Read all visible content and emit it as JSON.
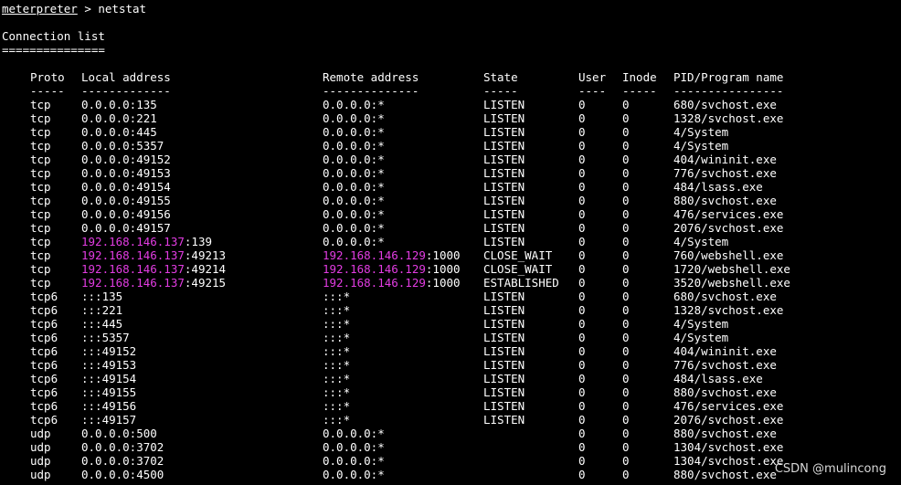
{
  "prompt": {
    "name": "meterpreter",
    "symbol": " > ",
    "command": "netstat"
  },
  "title": "Connection list",
  "title_rule": "===============",
  "headers": {
    "proto": "Proto",
    "local": "Local address",
    "remote": "Remote address",
    "state": "State",
    "user": "User",
    "inode": "Inode",
    "pid": "PID/Program name"
  },
  "rules": {
    "proto": "-----",
    "local": "-------------",
    "remote": "--------------",
    "state": "-----",
    "user": "----",
    "inode": "-----",
    "pid": "----------------"
  },
  "highlight_color": "#e23ce2",
  "connections": [
    {
      "proto": "tcp",
      "local_ip": "",
      "local_rest": "0.0.0.0:135",
      "remote_ip": "",
      "remote_rest": "0.0.0.0:*",
      "state": "LISTEN",
      "user": "0",
      "inode": "0",
      "pid": "680/svchost.exe"
    },
    {
      "proto": "tcp",
      "local_ip": "",
      "local_rest": "0.0.0.0:221",
      "remote_ip": "",
      "remote_rest": "0.0.0.0:*",
      "state": "LISTEN",
      "user": "0",
      "inode": "0",
      "pid": "1328/svchost.exe"
    },
    {
      "proto": "tcp",
      "local_ip": "",
      "local_rest": "0.0.0.0:445",
      "remote_ip": "",
      "remote_rest": "0.0.0.0:*",
      "state": "LISTEN",
      "user": "0",
      "inode": "0",
      "pid": "4/System"
    },
    {
      "proto": "tcp",
      "local_ip": "",
      "local_rest": "0.0.0.0:5357",
      "remote_ip": "",
      "remote_rest": "0.0.0.0:*",
      "state": "LISTEN",
      "user": "0",
      "inode": "0",
      "pid": "4/System"
    },
    {
      "proto": "tcp",
      "local_ip": "",
      "local_rest": "0.0.0.0:49152",
      "remote_ip": "",
      "remote_rest": "0.0.0.0:*",
      "state": "LISTEN",
      "user": "0",
      "inode": "0",
      "pid": "404/wininit.exe"
    },
    {
      "proto": "tcp",
      "local_ip": "",
      "local_rest": "0.0.0.0:49153",
      "remote_ip": "",
      "remote_rest": "0.0.0.0:*",
      "state": "LISTEN",
      "user": "0",
      "inode": "0",
      "pid": "776/svchost.exe"
    },
    {
      "proto": "tcp",
      "local_ip": "",
      "local_rest": "0.0.0.0:49154",
      "remote_ip": "",
      "remote_rest": "0.0.0.0:*",
      "state": "LISTEN",
      "user": "0",
      "inode": "0",
      "pid": "484/lsass.exe"
    },
    {
      "proto": "tcp",
      "local_ip": "",
      "local_rest": "0.0.0.0:49155",
      "remote_ip": "",
      "remote_rest": "0.0.0.0:*",
      "state": "LISTEN",
      "user": "0",
      "inode": "0",
      "pid": "880/svchost.exe"
    },
    {
      "proto": "tcp",
      "local_ip": "",
      "local_rest": "0.0.0.0:49156",
      "remote_ip": "",
      "remote_rest": "0.0.0.0:*",
      "state": "LISTEN",
      "user": "0",
      "inode": "0",
      "pid": "476/services.exe"
    },
    {
      "proto": "tcp",
      "local_ip": "",
      "local_rest": "0.0.0.0:49157",
      "remote_ip": "",
      "remote_rest": "0.0.0.0:*",
      "state": "LISTEN",
      "user": "0",
      "inode": "0",
      "pid": "2076/svchost.exe"
    },
    {
      "proto": "tcp",
      "local_ip": "192.168.146.137",
      "local_rest": ":139",
      "remote_ip": "",
      "remote_rest": "0.0.0.0:*",
      "state": "LISTEN",
      "user": "0",
      "inode": "0",
      "pid": "4/System"
    },
    {
      "proto": "tcp",
      "local_ip": "192.168.146.137",
      "local_rest": ":49213",
      "remote_ip": "192.168.146.129",
      "remote_rest": ":1000",
      "state": "CLOSE_WAIT",
      "user": "0",
      "inode": "0",
      "pid": "760/webshell.exe"
    },
    {
      "proto": "tcp",
      "local_ip": "192.168.146.137",
      "local_rest": ":49214",
      "remote_ip": "192.168.146.129",
      "remote_rest": ":1000",
      "state": "CLOSE_WAIT",
      "user": "0",
      "inode": "0",
      "pid": "1720/webshell.exe"
    },
    {
      "proto": "tcp",
      "local_ip": "192.168.146.137",
      "local_rest": ":49215",
      "remote_ip": "192.168.146.129",
      "remote_rest": ":1000",
      "state": "ESTABLISHED",
      "user": "0",
      "inode": "0",
      "pid": "3520/webshell.exe"
    },
    {
      "proto": "tcp6",
      "local_ip": "",
      "local_rest": ":::135",
      "remote_ip": "",
      "remote_rest": ":::*",
      "state": "LISTEN",
      "user": "0",
      "inode": "0",
      "pid": "680/svchost.exe"
    },
    {
      "proto": "tcp6",
      "local_ip": "",
      "local_rest": ":::221",
      "remote_ip": "",
      "remote_rest": ":::*",
      "state": "LISTEN",
      "user": "0",
      "inode": "0",
      "pid": "1328/svchost.exe"
    },
    {
      "proto": "tcp6",
      "local_ip": "",
      "local_rest": ":::445",
      "remote_ip": "",
      "remote_rest": ":::*",
      "state": "LISTEN",
      "user": "0",
      "inode": "0",
      "pid": "4/System"
    },
    {
      "proto": "tcp6",
      "local_ip": "",
      "local_rest": ":::5357",
      "remote_ip": "",
      "remote_rest": ":::*",
      "state": "LISTEN",
      "user": "0",
      "inode": "0",
      "pid": "4/System"
    },
    {
      "proto": "tcp6",
      "local_ip": "",
      "local_rest": ":::49152",
      "remote_ip": "",
      "remote_rest": ":::*",
      "state": "LISTEN",
      "user": "0",
      "inode": "0",
      "pid": "404/wininit.exe"
    },
    {
      "proto": "tcp6",
      "local_ip": "",
      "local_rest": ":::49153",
      "remote_ip": "",
      "remote_rest": ":::*",
      "state": "LISTEN",
      "user": "0",
      "inode": "0",
      "pid": "776/svchost.exe"
    },
    {
      "proto": "tcp6",
      "local_ip": "",
      "local_rest": ":::49154",
      "remote_ip": "",
      "remote_rest": ":::*",
      "state": "LISTEN",
      "user": "0",
      "inode": "0",
      "pid": "484/lsass.exe"
    },
    {
      "proto": "tcp6",
      "local_ip": "",
      "local_rest": ":::49155",
      "remote_ip": "",
      "remote_rest": ":::*",
      "state": "LISTEN",
      "user": "0",
      "inode": "0",
      "pid": "880/svchost.exe"
    },
    {
      "proto": "tcp6",
      "local_ip": "",
      "local_rest": ":::49156",
      "remote_ip": "",
      "remote_rest": ":::*",
      "state": "LISTEN",
      "user": "0",
      "inode": "0",
      "pid": "476/services.exe"
    },
    {
      "proto": "tcp6",
      "local_ip": "",
      "local_rest": ":::49157",
      "remote_ip": "",
      "remote_rest": ":::*",
      "state": "LISTEN",
      "user": "0",
      "inode": "0",
      "pid": "2076/svchost.exe"
    },
    {
      "proto": "udp",
      "local_ip": "",
      "local_rest": "0.0.0.0:500",
      "remote_ip": "",
      "remote_rest": "0.0.0.0:*",
      "state": "",
      "user": "0",
      "inode": "0",
      "pid": "880/svchost.exe"
    },
    {
      "proto": "udp",
      "local_ip": "",
      "local_rest": "0.0.0.0:3702",
      "remote_ip": "",
      "remote_rest": "0.0.0.0:*",
      "state": "",
      "user": "0",
      "inode": "0",
      "pid": "1304/svchost.exe"
    },
    {
      "proto": "udp",
      "local_ip": "",
      "local_rest": "0.0.0.0:3702",
      "remote_ip": "",
      "remote_rest": "0.0.0.0:*",
      "state": "",
      "user": "0",
      "inode": "0",
      "pid": "1304/svchost.exe"
    },
    {
      "proto": "udp",
      "local_ip": "",
      "local_rest": "0.0.0.0:4500",
      "remote_ip": "",
      "remote_rest": "0.0.0.0:*",
      "state": "",
      "user": "0",
      "inode": "0",
      "pid": "880/svchost.exe"
    }
  ],
  "watermark": "CSDN @mulincong"
}
